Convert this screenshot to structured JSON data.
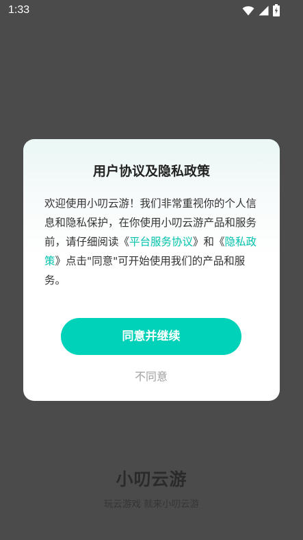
{
  "status_bar": {
    "time": "1:33",
    "icons": [
      "wifi-icon",
      "cellular-signal-icon",
      "battery-charging-icon"
    ]
  },
  "dialog": {
    "title": "用户协议及隐私政策",
    "body": {
      "text_1": "欢迎使用小叨云游！我们非常重视你的个人信息和隐私保护，在你使用小叨云游产品和服务前，请仔细阅读《",
      "link_1": "平台服务协议",
      "text_2": "》和《",
      "link_2": "隐私政策",
      "text_3": "》点击\"同意\"可开始使用我们的产品和服务。"
    },
    "agree_label": "同意并继续",
    "decline_label": "不同意"
  },
  "brand": {
    "name": "小叨云游",
    "slogan": "玩云游戏 就来小叨云游"
  },
  "colors": {
    "accent": "#00d2b9",
    "link": "#00c2ad",
    "overlay": "#4b4b4b"
  }
}
